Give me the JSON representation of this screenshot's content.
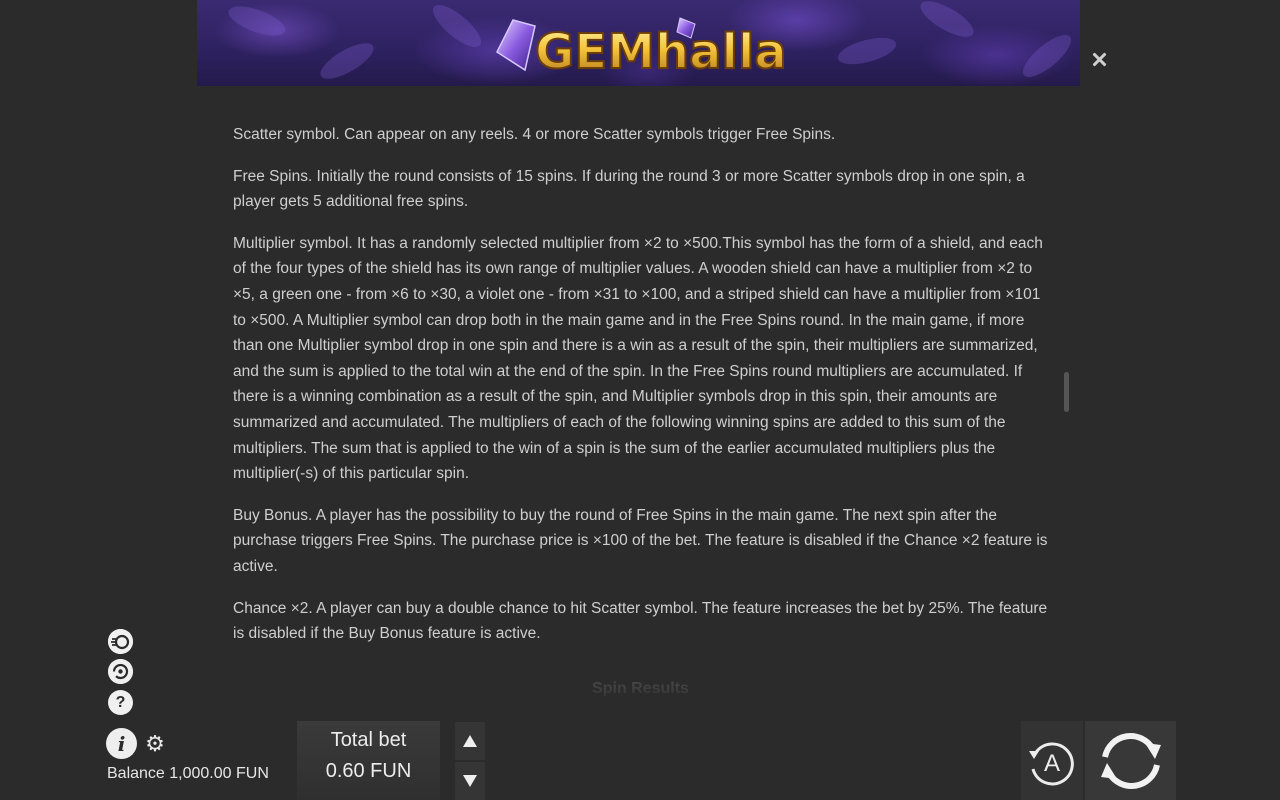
{
  "header": {
    "logo_text": "GEMhalla",
    "close_icon": "close-icon"
  },
  "rules": {
    "paragraphs": [
      "Scatter symbol. Can appear on any reels. 4 or more Scatter symbols trigger Free Spins.",
      "Free Spins. Initially the round consists of 15 spins. If during the round 3 or more Scatter symbols drop in one spin, a player gets 5 additional free spins.",
      "Multiplier symbol. It has a randomly selected multiplier from ×2 to ×500.This symbol has the form of a shield, and each of the four types of the shield has its own range of multiplier values. A wooden shield can have a multiplier from ×2 to ×5, a green one - from ×6 to ×30, a violet one - from ×31 to ×100, and a striped shield can have a multiplier from ×101 to ×500. A Multiplier symbol can drop both in the main game and in the Free Spins round. In the main game, if more than one Multiplier symbol drop in one spin and there is a win as a result of the spin, their multipliers are summarized, and the sum is applied to the total win at the end of the spin. In the Free Spins round multipliers are accumulated. If there is a winning combination as a result of the spin, and Multiplier symbols drop in this spin, their amounts are summarized and accumulated. The multipliers of each of the following winning spins are added to this sum of the multipliers. The sum that is applied to the win of a spin is the sum of the earlier accumulated multipliers plus the multiplier(-s) of this particular spin.",
      "Buy Bonus. A player has the possibility to buy the round of Free Spins in the main game. The next spin after the purchase triggers Free Spins. The purchase price is ×100 of the bet. The feature is disabled if the Chance ×2 feature is active.",
      "Chance ×2. A player can buy a double chance to hit Scatter symbol. The feature increases the bet by 25%. The feature is disabled if the Buy Bonus feature is active."
    ],
    "next_section_title": "Spin Results"
  },
  "side_controls": {
    "turbo_icon": "turbo-spin-icon",
    "autoplay_settings_icon": "autoplay-settings-icon",
    "help_label": "?",
    "info_label": "i",
    "settings_icon": "gear-icon"
  },
  "balance": {
    "text": "Balance 1,000.00 FUN"
  },
  "bet": {
    "label": "Total bet",
    "value": "0.60 FUN"
  },
  "controls": {
    "auto_label": "A",
    "spin_icon": "spin-arrows-icon"
  }
}
